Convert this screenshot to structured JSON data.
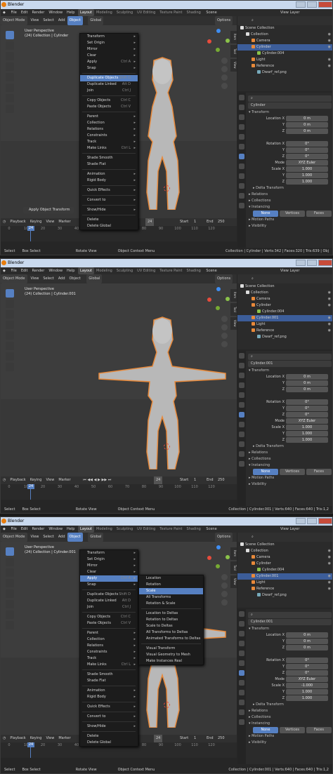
{
  "app": {
    "title": "Blender"
  },
  "menubar": {
    "items": [
      "File",
      "Edit",
      "Render",
      "Window",
      "Help"
    ],
    "workspaces": [
      "Layout",
      "Modeling",
      "Sculpting",
      "UV Editing",
      "Texture Paint",
      "Shading"
    ],
    "scene": "Scene",
    "view_layer": "View Layer"
  },
  "header": {
    "mode": "Object Mode",
    "menus": [
      "View",
      "Select",
      "Add",
      "Object"
    ],
    "orientation": "Global",
    "options": "Options"
  },
  "colors": {
    "accent": "#5680c2",
    "selection": "#e8893a",
    "x_axis": "#e74c3c",
    "y_axis": "#8bc34a",
    "z_axis": "#3f8ef2"
  },
  "outliner": {
    "rows": [
      {
        "label": "Scene Collection",
        "icon": "collection-icon"
      },
      {
        "label": "Collection",
        "icon": "collection-icon"
      },
      {
        "label": "Camera",
        "icon": "camera-icon"
      },
      {
        "label": "Cylinder",
        "icon": "mesh-icon"
      },
      {
        "label": "Cylinder.004",
        "icon": "mesh-icon"
      },
      {
        "label": "Light",
        "icon": "light-icon"
      },
      {
        "label": "Reference",
        "icon": "empty-icon"
      },
      {
        "label": "Dwarf_ref.png",
        "icon": "image-icon"
      }
    ],
    "rows2": [
      {
        "label": "Scene Collection",
        "icon": "collection-icon"
      },
      {
        "label": "Collection",
        "icon": "collection-icon"
      },
      {
        "label": "Camera",
        "icon": "camera-icon"
      },
      {
        "label": "Cylinder",
        "icon": "mesh-icon"
      },
      {
        "label": "Cylinder.004",
        "icon": "mesh-icon"
      },
      {
        "label": "Cylinder.001",
        "icon": "mesh-icon"
      },
      {
        "label": "Light",
        "icon": "light-icon"
      },
      {
        "label": "Reference",
        "icon": "empty-icon"
      },
      {
        "label": "Dwarf_ref.png",
        "icon": "image-icon"
      }
    ]
  },
  "panels": [
    {
      "viewport_line1": "User Perspective",
      "viewport_line2": "(24) Collection | Cylinder",
      "object_name": "Cylinder",
      "scale": [
        "1.000",
        "1.000",
        "1.000"
      ],
      "status_stats": "Collection | Cylinder | Verts:342 | Faces:320 | Tris:639 | Obj"
    },
    {
      "viewport_line1": "User Perspective",
      "viewport_line2": "(24) Collection | Cylinder.001",
      "object_name": "Cylinder.001",
      "scale": [
        "1.000",
        "1.000",
        "1.000"
      ],
      "status_stats": "Collection | Cylinder.001 | Verts:640 | Faces:640 | Tris:1,2"
    },
    {
      "viewport_line1": "User Perspective",
      "viewport_line2": "(24) Collection | Cylinder.001",
      "object_name": "Cylinder.001",
      "scale": [
        "-1.000",
        "1.000",
        "1.000"
      ],
      "status_stats": "Collection | Cylinder.001 | Verts:640 | Faces:640 | Tris:1,2"
    }
  ],
  "properties": {
    "section": "Transform",
    "location_label": "Location X",
    "loc": [
      "0 m",
      "0 m",
      "0 m"
    ],
    "rotation_label": "Rotation X",
    "rot": [
      "0°",
      "0°",
      "0°"
    ],
    "mode_label": "Mode",
    "mode": "XYZ Euler",
    "scale_label": "Scale X",
    "y": "Y",
    "z": "Z",
    "collapsed": [
      "Delta Transform",
      "Relations",
      "Collections",
      "Instancing"
    ],
    "instancing": [
      "None",
      "Vertices",
      "Faces"
    ],
    "more": [
      "Motion Paths",
      "Visibility"
    ]
  },
  "timeline": {
    "menus": [
      "Playback",
      "Keying",
      "View",
      "Marker"
    ],
    "frame": "24",
    "start_label": "Start",
    "start": "1",
    "end_label": "End",
    "end": "250",
    "ticks": [
      "0",
      "10",
      "20",
      "30",
      "40",
      "50",
      "60",
      "70",
      "80",
      "90",
      "100",
      "110",
      "120",
      "130"
    ]
  },
  "status": {
    "select": "Select",
    "box": "Box Select",
    "rotate": "Rotate View",
    "context": "Object Context Menu"
  },
  "tooltip": "Apply Object Transform",
  "object_menu": [
    {
      "label": "Transform",
      "arrow": true
    },
    {
      "label": "Set Origin",
      "arrow": true
    },
    {
      "label": "Mirror",
      "arrow": true
    },
    {
      "label": "Clear",
      "arrow": true
    },
    {
      "label": "Apply",
      "shortcut": "Ctrl A",
      "arrow": true
    },
    {
      "label": "Snap",
      "arrow": true
    },
    {
      "sep": true
    },
    {
      "label": "Duplicate Objects",
      "shortcut": "Shift D"
    },
    {
      "label": "Duplicate Linked",
      "shortcut": "Alt D"
    },
    {
      "label": "Join",
      "shortcut": "Ctrl J"
    },
    {
      "sep": true
    },
    {
      "label": "Copy Objects",
      "shortcut": "Ctrl C"
    },
    {
      "label": "Paste Objects",
      "shortcut": "Ctrl V"
    },
    {
      "sep": true
    },
    {
      "label": "Parent",
      "arrow": true
    },
    {
      "label": "Collection",
      "arrow": true
    },
    {
      "label": "Relations",
      "arrow": true
    },
    {
      "label": "Constraints",
      "arrow": true
    },
    {
      "label": "Track",
      "arrow": true
    },
    {
      "label": "Make Links",
      "shortcut": "Ctrl L",
      "arrow": true
    },
    {
      "sep": true
    },
    {
      "label": "Shade Smooth"
    },
    {
      "label": "Shade Flat"
    },
    {
      "sep": true
    },
    {
      "label": "Animation",
      "arrow": true
    },
    {
      "label": "Rigid Body",
      "arrow": true
    },
    {
      "sep": true
    },
    {
      "label": "Quick Effects",
      "arrow": true
    },
    {
      "sep": true
    },
    {
      "label": "Convert to",
      "arrow": true
    },
    {
      "sep": true
    },
    {
      "label": "Show/Hide",
      "arrow": true
    },
    {
      "sep": true
    },
    {
      "label": "Delete"
    },
    {
      "label": "Delete Global"
    }
  ],
  "apply_menu": [
    {
      "label": "Location"
    },
    {
      "label": "Rotation"
    },
    {
      "label": "Scale"
    },
    {
      "label": "All Transforms"
    },
    {
      "label": "Rotation & Scale"
    },
    {
      "sep": true
    },
    {
      "label": "Location to Deltas"
    },
    {
      "label": "Rotation to Deltas"
    },
    {
      "label": "Scale to Deltas"
    },
    {
      "label": "All Transforms to Deltas"
    },
    {
      "label": "Animated Transforms to Deltas"
    },
    {
      "sep": true
    },
    {
      "label": "Visual Transform"
    },
    {
      "label": "Visual Geometry to Mesh"
    },
    {
      "label": "Make Instances Real"
    }
  ]
}
